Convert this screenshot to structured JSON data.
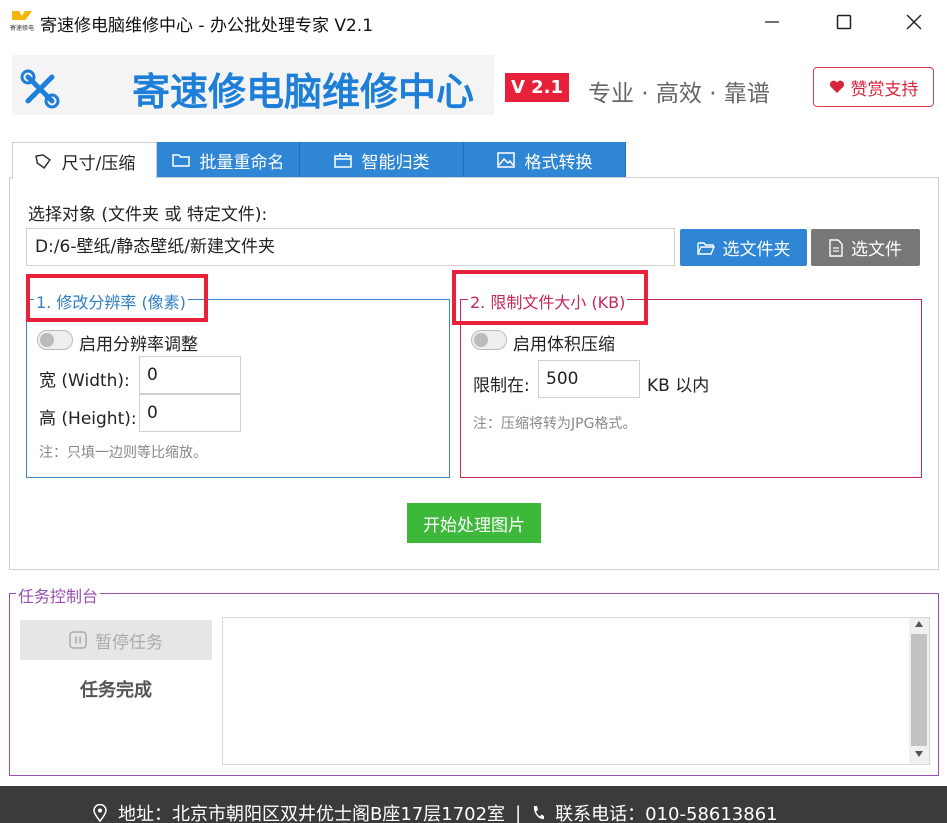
{
  "window": {
    "title": "寄速修电脑维修中心 - 办公批处理专家 V2.1",
    "logo_text": "寄速修电"
  },
  "header": {
    "brand_title": "寄速修电脑维修中心",
    "version": "V 2.1",
    "tagline": "专业 · 高效 · 靠谱",
    "donate_label": "赞赏支持"
  },
  "tabs": [
    {
      "label": "尺寸/压缩",
      "icon": "tag-icon",
      "active": true
    },
    {
      "label": "批量重命名",
      "icon": "folder-icon",
      "active": false
    },
    {
      "label": "智能归类",
      "icon": "archive-icon",
      "active": false
    },
    {
      "label": "格式转换",
      "icon": "image-icon",
      "active": false
    }
  ],
  "target": {
    "label": "选择对象 (文件夹 或 特定文件):",
    "path": "D:/6-壁纸/静态壁纸/新建文件夹",
    "select_folder_label": "选文件夹",
    "select_file_label": "选文件"
  },
  "resolution": {
    "legend": "1. 修改分辨率 (像素)",
    "toggle_label": "启用分辨率调整",
    "enabled": false,
    "width_label": "宽 (Width):",
    "width_value": "0",
    "height_label": "高 (Height):",
    "height_value": "0",
    "note": "注：只填一边则等比缩放。"
  },
  "filesize": {
    "legend": "2. 限制文件大小 (KB)",
    "toggle_label": "启用体积压缩",
    "enabled": false,
    "limit_label": "限制在:",
    "limit_value": "500",
    "unit_label": "KB 以内",
    "note": "注：压缩将转为JPG格式。"
  },
  "actions": {
    "start_label": "开始处理图片"
  },
  "console": {
    "legend": "任务控制台",
    "pause_label": "暂停任务",
    "status": "任务完成",
    "log": ""
  },
  "footer": {
    "address": "地址：北京市朝阳区双井优士阁B座17层1702室",
    "separator": "|",
    "phone": "联系电话：010-58613861"
  },
  "colors": {
    "accent_blue": "#2f86d4",
    "brand_blue": "#1e7fd8",
    "badge_red": "#e8213a",
    "start_green": "#3db83a",
    "size_group_border": "#c8265a",
    "console_border": "#9a4fb0"
  }
}
